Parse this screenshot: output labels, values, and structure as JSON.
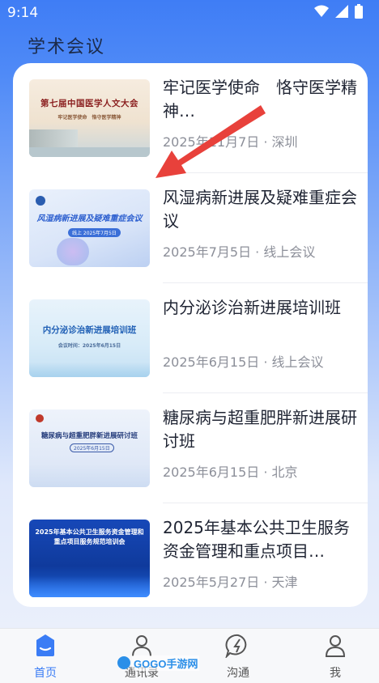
{
  "status": {
    "time": "9:14"
  },
  "page": {
    "title": "学术会议"
  },
  "items": [
    {
      "title": "牢记医学使命　恪守医学精神…",
      "meta": "2025年11月7日 · 深圳",
      "thumb": {
        "text": "第七届中国医学人文大会",
        "sub": "牢记医学使命　恪守医学精神"
      }
    },
    {
      "title": "风湿病新进展及疑难重症会议",
      "meta": "2025年7月5日 · 线上会议",
      "thumb": {
        "text": "风湿病新进展及疑难重症会议",
        "sub": "线上 2025年7月5日"
      }
    },
    {
      "title": "内分泌诊治新进展培训班",
      "meta": "2025年6月15日 · 线上会议",
      "thumb": {
        "text": "内分泌诊治新进展培训班",
        "sub": "会议时间：2025年6月15日"
      }
    },
    {
      "title": "糖尿病与超重肥胖新进展研讨班",
      "meta": "2025年6月15日 · 北京",
      "thumb": {
        "text": "糖尿病与超重肥胖新进展研讨班",
        "sub": "2025年6月15日"
      }
    },
    {
      "title": "2025年基本公共卫生服务资金管理和重点项目…",
      "meta": "2025年5月27日 · 天津",
      "thumb": {
        "text": "2025年基本公共卫生服务资金管理和重点项目服务规范培训会",
        "sub": ""
      }
    }
  ],
  "tabs": [
    {
      "label": "首页",
      "icon": "home-icon",
      "active": true
    },
    {
      "label": "通讯录",
      "icon": "contacts-icon",
      "active": false
    },
    {
      "label": "沟通",
      "icon": "chat-icon",
      "active": false
    },
    {
      "label": "我",
      "icon": "profile-icon",
      "active": false
    }
  ],
  "watermark": {
    "text": "GOGO手游网"
  },
  "colors": {
    "accent": "#3a7cf5",
    "text": "#1f2433",
    "muted": "#8c8f99",
    "arrow": "#e8413b"
  }
}
